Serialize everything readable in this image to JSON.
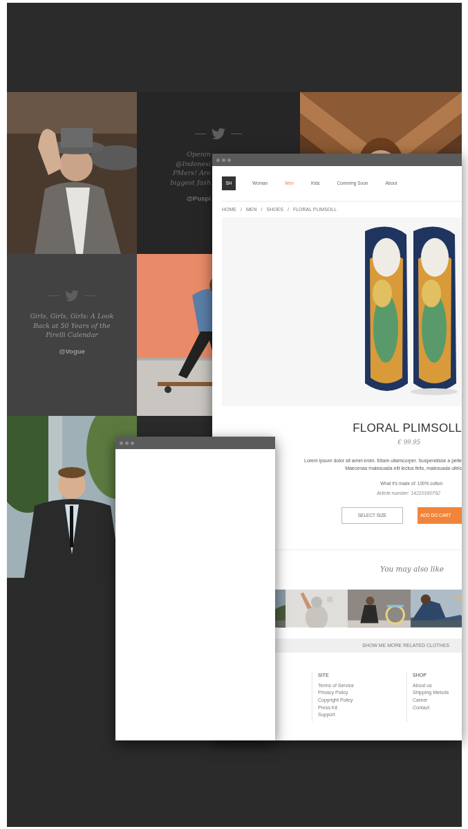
{
  "tiles": [
    {
      "kind": "picture"
    },
    {
      "kind": "tweet",
      "dark": true,
      "text_lines": [
        "Openin",
        "@Indonesi",
        "PMers! Are",
        "biggest fash"
      ],
      "handle": "@Puspi"
    },
    {
      "kind": "picture"
    },
    {
      "kind": "tweet",
      "dark": false,
      "text_lines": [
        "Girls, Girls, Girls: A Look",
        "Back at 50 Years of the",
        "Pirelli Calendar"
      ],
      "handle": "@Vogue"
    },
    {
      "kind": "picture"
    },
    {
      "kind": "empty"
    },
    {
      "kind": "picture"
    }
  ],
  "product_window": {
    "logo": "SH",
    "nav": [
      {
        "label": "Woman",
        "selected": false
      },
      {
        "label": "Men",
        "selected": true
      },
      {
        "label": "Kids",
        "selected": false
      },
      {
        "label": "Comming Soon",
        "selected": false
      },
      {
        "label": "About",
        "selected": false
      }
    ],
    "breadcrumb": {
      "items": [
        "HOME",
        "MEN",
        "SHOES",
        "FLORAL PLIMSOLL"
      ],
      "separator": "/"
    },
    "product": {
      "title": "FLORAL PLIMSOLL",
      "price": "€ 99.95",
      "description_lines": [
        "Lorem ipsum dolor sit amet enim. Etiam ullamcorper. Suspendisse a pelle",
        "Maecenas malesuada elit lectus felis, malesuada ultric"
      ],
      "material": "What it's made of: 100% cotton",
      "article": "Article number: 14210160762",
      "buttons": [
        {
          "label": "SELECT SIZE",
          "kind": "outline"
        },
        {
          "label": "ADD DO CART",
          "kind": "primary"
        }
      ]
    },
    "related": {
      "heading": "You may also like",
      "more_button": "SHOW ME MORE RELATED CLOTHES"
    },
    "footer": {
      "columns": [
        {
          "heading": "SITE",
          "links": [
            "Terms of Service",
            "Privacy Policy",
            "Copyright Policy",
            "Press Kit",
            "Support"
          ]
        },
        {
          "heading": "SHOP",
          "links": [
            "About us",
            "Shipping Metods",
            "Career",
            "Contact"
          ]
        }
      ]
    }
  }
}
